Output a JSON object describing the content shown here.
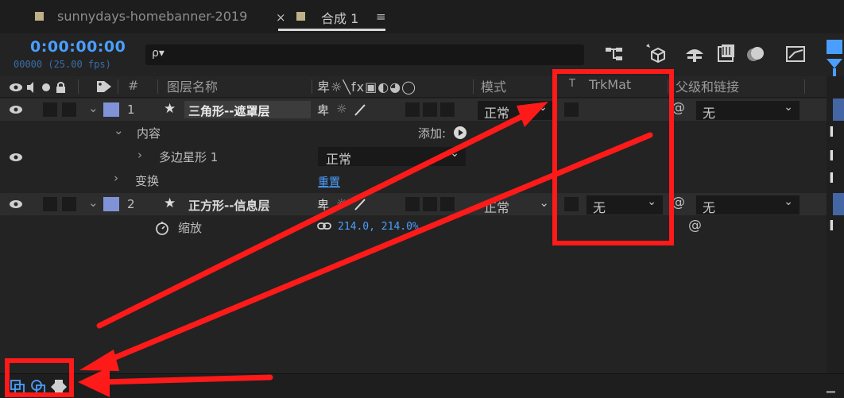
{
  "tabs": [
    {
      "label": "sunnydays-homebanner-2019",
      "close": "×"
    },
    {
      "label": "合成 1",
      "menu": "≡"
    }
  ],
  "timecode": "0:00:00:00",
  "frame_info": "00000 (25.00 fps)",
  "search": {
    "placeholder": "",
    "icon": "ρ▾"
  },
  "header": {
    "layer_name": "图层名称",
    "hash": "#",
    "mode": "模式",
    "t": "T",
    "trkmat": "TrkMat",
    "parent": "父级和链接",
    "switches": "卑☼╲fx▣◐◕◯"
  },
  "layers": [
    {
      "index": "1",
      "name": "三角形--遮罩层",
      "mode": "正常",
      "trkmat": "",
      "parent": "无",
      "contents_label": "内容",
      "add_label": "添加:",
      "star_shape": "多边星形 1",
      "star_mode": "正常",
      "transform_label": "变换",
      "reset_label": "重置"
    },
    {
      "index": "2",
      "name": "正方形--信息层",
      "mode": "正常",
      "trkmat": "无",
      "parent": "无",
      "scale_label": "缩放",
      "scale_value": "214.0, 214.0%"
    }
  ],
  "colors": {
    "label": "#8093d6",
    "accent": "#4a9eff",
    "annotation": "#ff1a1a"
  }
}
